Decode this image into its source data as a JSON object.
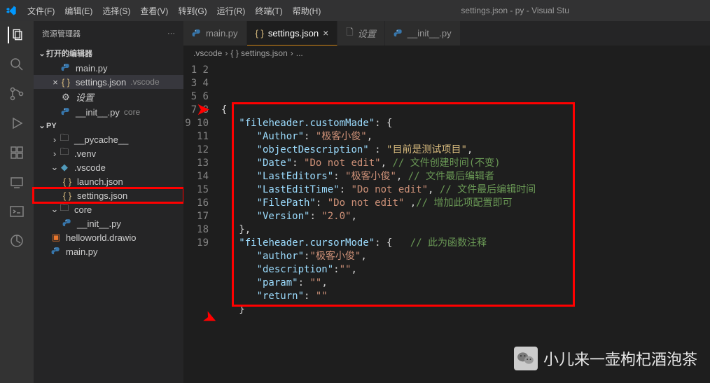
{
  "window_title": "settings.json - py - Visual Stu",
  "menus": [
    "文件(F)",
    "编辑(E)",
    "选择(S)",
    "查看(V)",
    "转到(G)",
    "运行(R)",
    "终端(T)",
    "帮助(H)"
  ],
  "sidebar": {
    "header": "资源管理器",
    "open_editors_label": "打开的编辑器",
    "open_editors": [
      {
        "icon": "python",
        "label": "main.py",
        "suffix": ""
      },
      {
        "icon": "json",
        "label": "settings.json",
        "suffix": ".vscode",
        "active": true
      },
      {
        "icon": "gear",
        "label": "设置",
        "suffix": "",
        "italic": true
      },
      {
        "icon": "python",
        "label": "__init__.py",
        "suffix": "core"
      }
    ],
    "project_label": "PY",
    "tree": [
      {
        "type": "folder",
        "label": "__pycache__",
        "indent": 1,
        "open": false
      },
      {
        "type": "folder",
        "label": ".venv",
        "indent": 1,
        "open": false
      },
      {
        "type": "folder",
        "label": ".vscode",
        "indent": 1,
        "open": true,
        "vs": true
      },
      {
        "type": "file",
        "icon": "json",
        "label": "launch.json",
        "indent": 2
      },
      {
        "type": "file",
        "icon": "json",
        "label": "settings.json",
        "indent": 2,
        "highlighted": true
      },
      {
        "type": "folder",
        "label": "core",
        "indent": 1,
        "open": true
      },
      {
        "type": "file",
        "icon": "python",
        "label": "__init__.py",
        "indent": 2
      },
      {
        "type": "file",
        "icon": "drawio",
        "label": "helloworld.drawio",
        "indent": 1
      },
      {
        "type": "file",
        "icon": "python",
        "label": "main.py",
        "indent": 1
      }
    ]
  },
  "tabs": [
    {
      "icon": "python",
      "label": "main.py"
    },
    {
      "icon": "json",
      "label": "settings.json",
      "active": true,
      "close": true
    },
    {
      "icon": "gear",
      "label": "设置",
      "italic": true
    },
    {
      "icon": "python",
      "label": "__init__.py"
    }
  ],
  "breadcrumb": [
    ".vscode",
    "{ } settings.json",
    "..."
  ],
  "code": {
    "lines": [
      1,
      2,
      3,
      4,
      5,
      6,
      7,
      8,
      9,
      10,
      11,
      12,
      13,
      14,
      15,
      16,
      17,
      18,
      19
    ],
    "l4": "{",
    "l5_key": "\"fileheader.customMade\"",
    "l5_rest": ": {",
    "l6_key": "\"Author\"",
    "l6_val": "\"极客小俊\"",
    "l7_key": "\"objectDescription\"",
    "l7_val": "\"目前是测试项目\"",
    "l8_key": "\"Date\"",
    "l8_val": "\"Do not edit\"",
    "l8_com": "// 文件创建时间(不变)",
    "l9_key": "\"LastEditors\"",
    "l9_val": "\"极客小俊\"",
    "l9_com": "// 文件最后编辑者",
    "l10_key": "\"LastEditTime\"",
    "l10_val": "\"Do not edit\"",
    "l10_com": "// 文件最后编辑时间",
    "l11_key": "\"FilePath\"",
    "l11_val": "\"Do not edit\"",
    "l11_com": "// 增加此项配置即可",
    "l12_key": "\"Version\"",
    "l12_val": "\"2.0\"",
    "l13": "},",
    "l14_key": "\"fileheader.cursorMode\"",
    "l14_rest": ": {",
    "l14_com": "// 此为函数注释",
    "l15_key": "\"author\"",
    "l15_val": "\"极客小俊\"",
    "l16_key": "\"description\"",
    "l16_val": "\"\"",
    "l17_key": "\"param\"",
    "l17_val": "\"\"",
    "l18_key": "\"return\"",
    "l18_val": "\"\"",
    "l19": "}"
  },
  "watermark": "小儿来一壶枸杞酒泡茶"
}
